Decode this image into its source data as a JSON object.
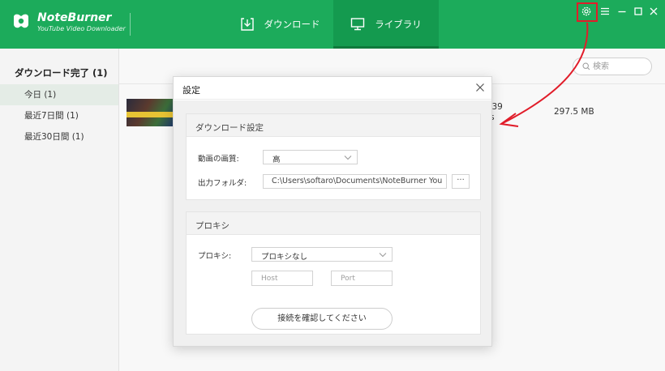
{
  "app": {
    "name": "NoteBurner",
    "subtitle": "YouTube Video Downloader"
  },
  "tabs": [
    {
      "label": "ダウンロード",
      "icon": "download-icon"
    },
    {
      "label": "ライブラリ",
      "icon": "monitor-icon",
      "active": true
    }
  ],
  "window_controls": [
    "gear-icon",
    "menu-icon",
    "minimize-icon",
    "maximize-icon",
    "close-icon"
  ],
  "sidebar": {
    "title": "ダウンロード完了 (1)",
    "items": [
      {
        "label": "今日 (1)",
        "active": true
      },
      {
        "label": "最近7日間 (1)"
      },
      {
        "label": "最近30日間 (1)"
      }
    ]
  },
  "search": {
    "placeholder": "検索"
  },
  "library_row": {
    "title_line1": "ns 39",
    "title_line2": "ads",
    "size": "297.5 MB"
  },
  "settings": {
    "title": "設定",
    "download_section": {
      "title": "ダウンロード設定",
      "quality_label": "動画の画質:",
      "quality_value": "高",
      "folder_label": "出力フォルダ:",
      "folder_value": "C:\\Users\\softaro\\Documents\\NoteBurner You",
      "browse_label": "···"
    },
    "proxy_section": {
      "title": "プロキシ",
      "proxy_label": "プロキシ:",
      "proxy_value": "プロキシなし",
      "host_placeholder": "Host",
      "port_placeholder": "Port",
      "confirm_label": "接続を確認してください"
    }
  },
  "colors": {
    "header": "#1cab5b",
    "active_tab": "#149a4f",
    "annotation": "#e11d2a"
  }
}
